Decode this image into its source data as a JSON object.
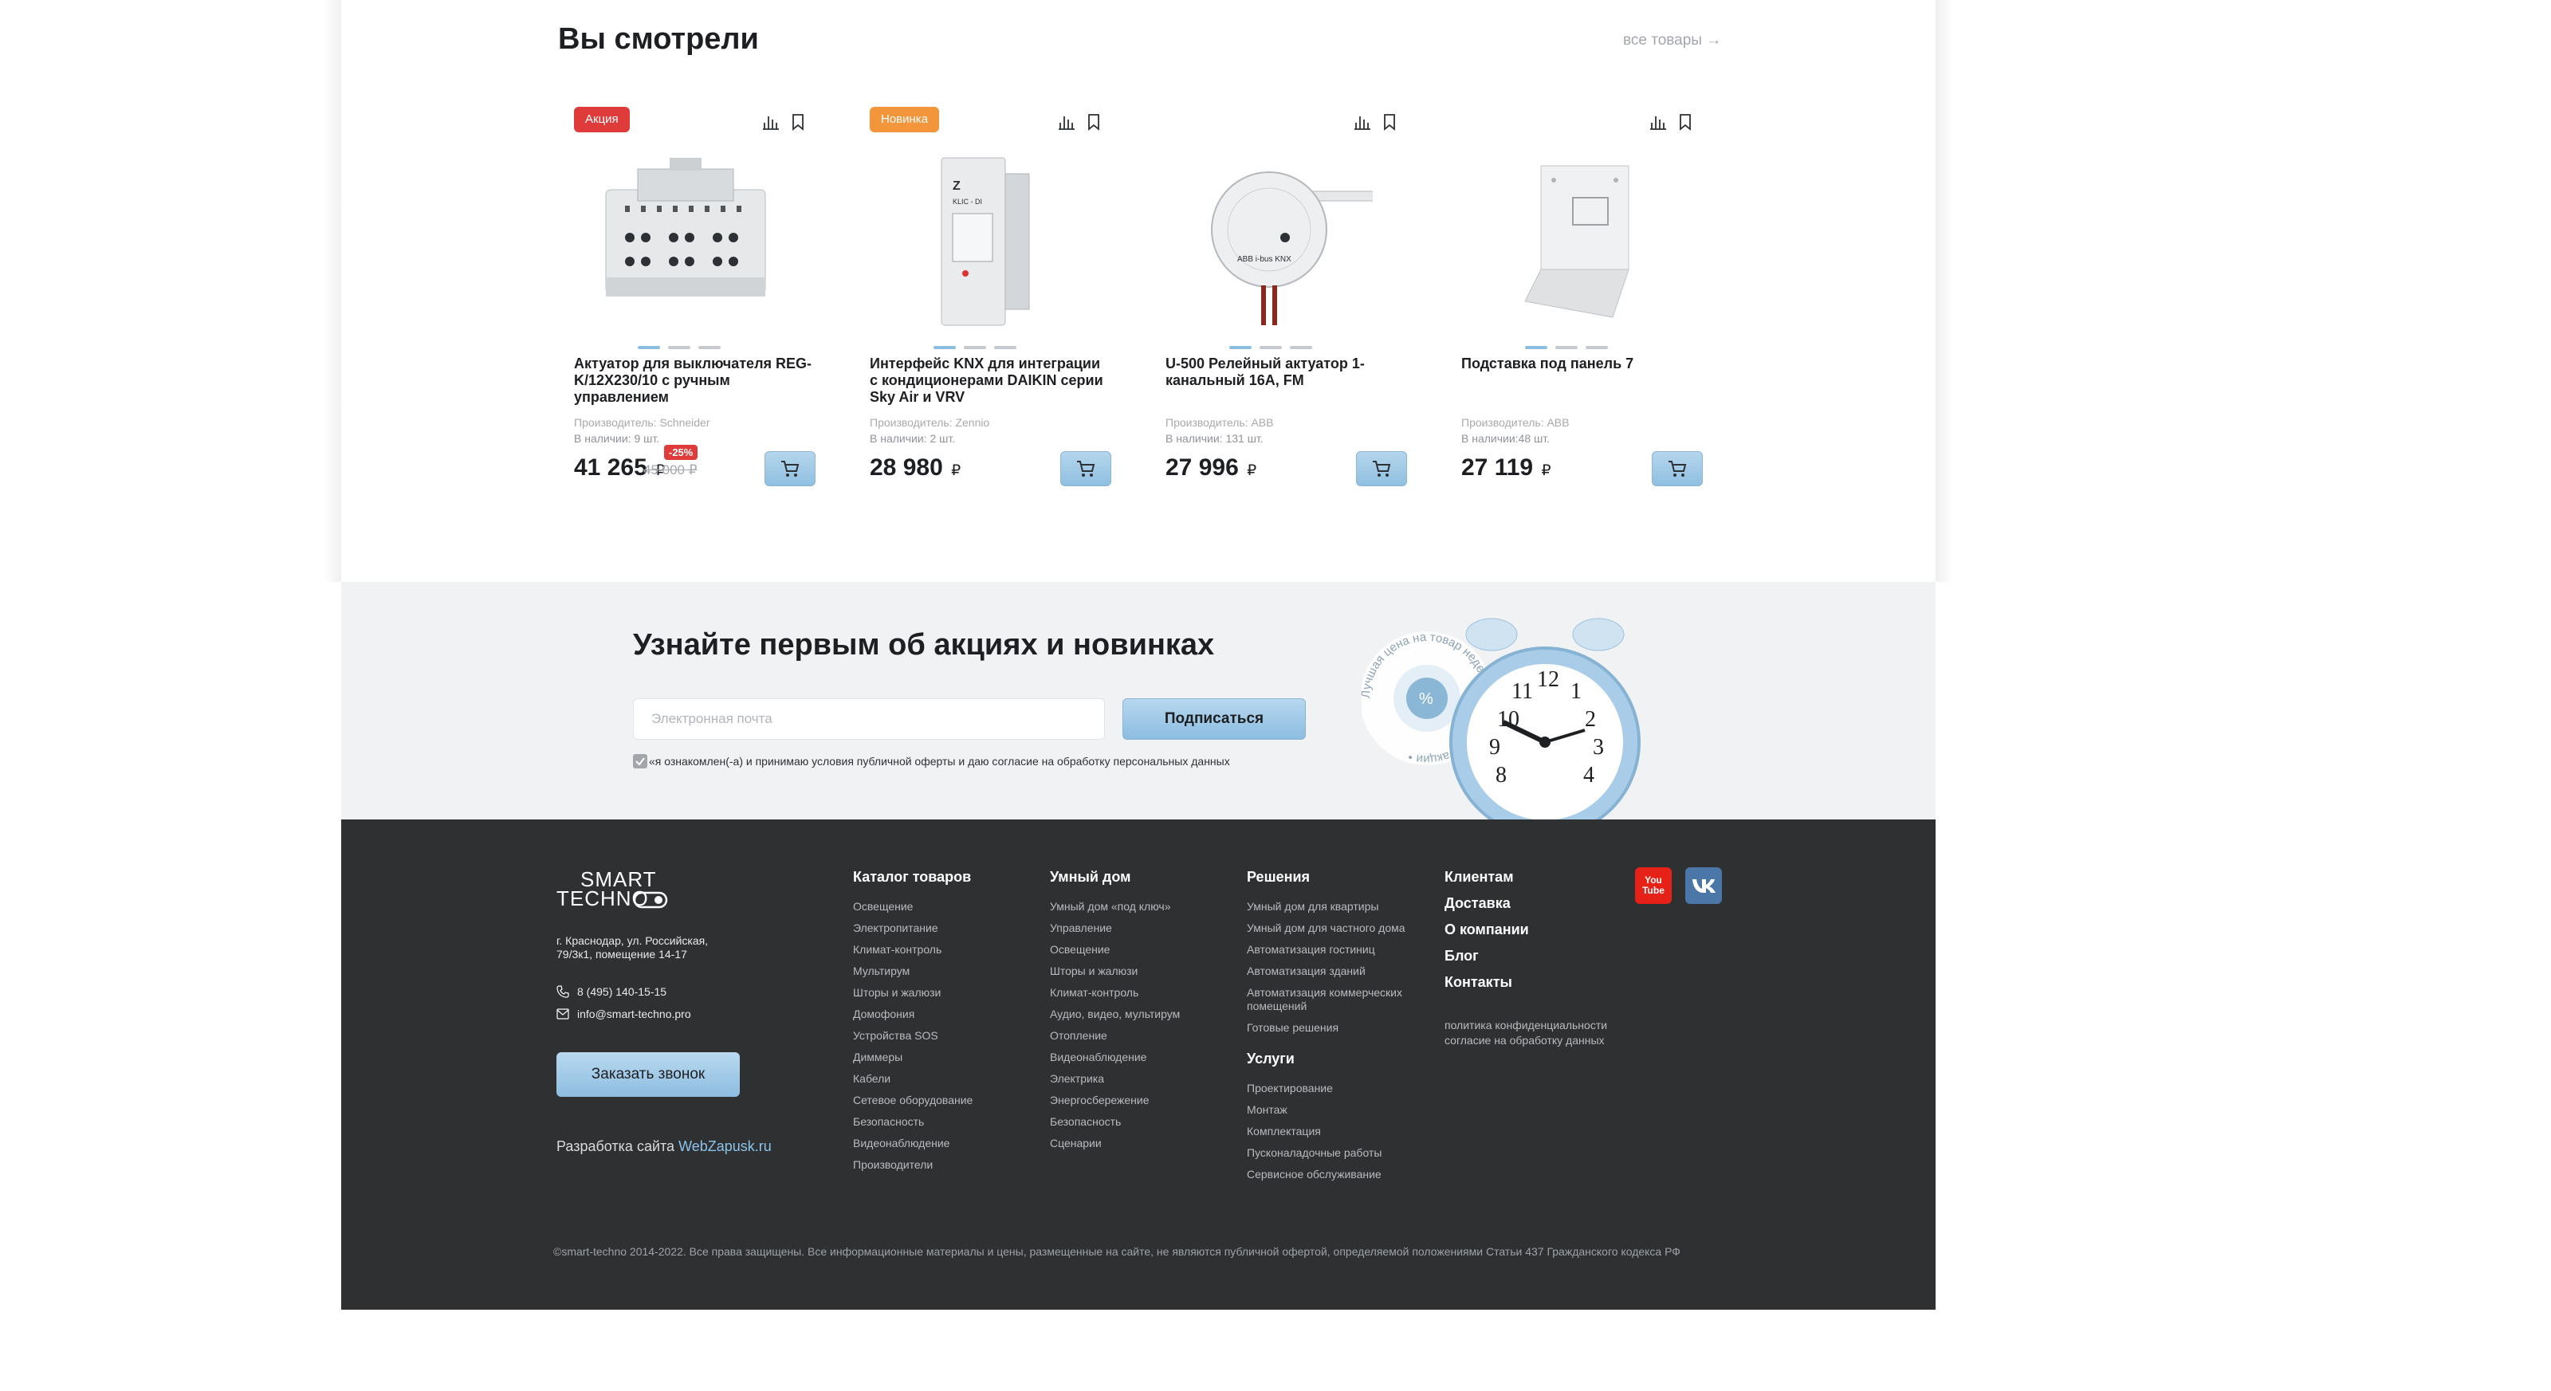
{
  "viewed": {
    "title": "Вы смотрели",
    "all_link": "все товары →"
  },
  "products": [
    {
      "badge": "Акция",
      "badge_color": "#e03b3b",
      "name": "Актуатор для выключателя REG-K/12X230/10 с ручным управлением",
      "maker": "Производитель: Schneider",
      "stock": "В наличии: 9 шт.",
      "price": "41 265",
      "currency": "₽",
      "old_price": "45 000 ₽",
      "discount": "-25%"
    },
    {
      "badge": "Новинка",
      "badge_color": "#f3953a",
      "name": "Интерфейс KNX для интеграции с кондиционерами DAIKIN серии Sky Air и VRV",
      "maker": "Производитель: Zennio",
      "stock": "В наличии: 2 шт.",
      "price": "28 980",
      "currency": "₽"
    },
    {
      "name": "U-500 Релейный актуатор 1-канальный 16А, FM",
      "maker": "Производитель: ABB",
      "stock": "В наличии: 131 шт.",
      "price": "27 996",
      "currency": "₽"
    },
    {
      "name": "Подставка под панель 7",
      "maker": "Производитель: ABB",
      "stock": "В наличии:48 шт.",
      "price": "27 119",
      "currency": "₽"
    }
  ],
  "subscribe": {
    "title": "Узнайте первым об акциях и новинках",
    "email_placeholder": "Электронная почта",
    "button": "Подписаться",
    "agree": "«я ознакомлен(-а) и принимаю условия публичной оферты и даю согласие на обработку персональных данных",
    "stamp_text": "Лучшая цена на товар недели • Актуальные акции •"
  },
  "footer": {
    "logo_line1": "SMART",
    "logo_line2": "TECHNO",
    "address": "г. Краснодар, ул. Российская, 79/3к1, помещение 14-17",
    "phone": "8 (495) 140-15-15",
    "email": "info@smart-techno.pro",
    "call_button": "Заказать звонок",
    "dev_prefix": "Разработка сайта",
    "dev_link": "WebZapusk.ru",
    "catalog": {
      "title": "Каталог товаров",
      "items": [
        "Освещение",
        "Электропитание",
        "Климат-контроль",
        "Мультирум",
        "Шторы и жалюзи",
        "Домофония",
        "Устройства SOS",
        "Диммеры",
        "Кабели",
        "Сетевое оборудование",
        "Безопасность",
        "Видеонаблюдение",
        "Производители"
      ]
    },
    "smart_home": {
      "title": "Умный дом",
      "items": [
        "Умный дом «под ключ»",
        "Управление",
        "Освещение",
        "Шторы и жалюзи",
        "Климат-контроль",
        "Аудио, видео, мультирум",
        "Отопление",
        "Видеонаблюдение",
        "Электрика",
        "Энергосбережение",
        "Безопасность",
        "Сценарии"
      ]
    },
    "solutions": {
      "title": "Решения",
      "items": [
        "Умный дом для квартиры",
        "Умный дом для частного дома",
        "Автоматизация гостиниц",
        "Автоматизация зданий",
        "Автоматизация коммерческих помещений",
        "Готовые решения"
      ]
    },
    "services": {
      "title": "Услуги",
      "items": [
        "Проектирование",
        "Монтаж",
        "Комплектация",
        "Пусконаладочные работы",
        "Сервисное обслуживание"
      ]
    },
    "clients": {
      "items": [
        "Клиентам",
        "Доставка",
        "О компании",
        "Блог",
        "Контакты"
      ],
      "privacy": "политика конфиденциальности",
      "consent": "согласие на обработку данных"
    },
    "youtube_text": "You Tube",
    "copyright": "©smart-techno 2014-2022. Все права защищены. Все информационные материалы и цены, размещенные на сайте, не являются публичной офертой, определяемой положениями Статьи 437 Гражданского кодекса РФ"
  },
  "colors": {
    "accent": "#8cbde0",
    "footer_bg": "#2e3032",
    "subscribe_bg": "#f1f2f4",
    "youtube": "#e62117",
    "vk": "#4a76a8"
  }
}
